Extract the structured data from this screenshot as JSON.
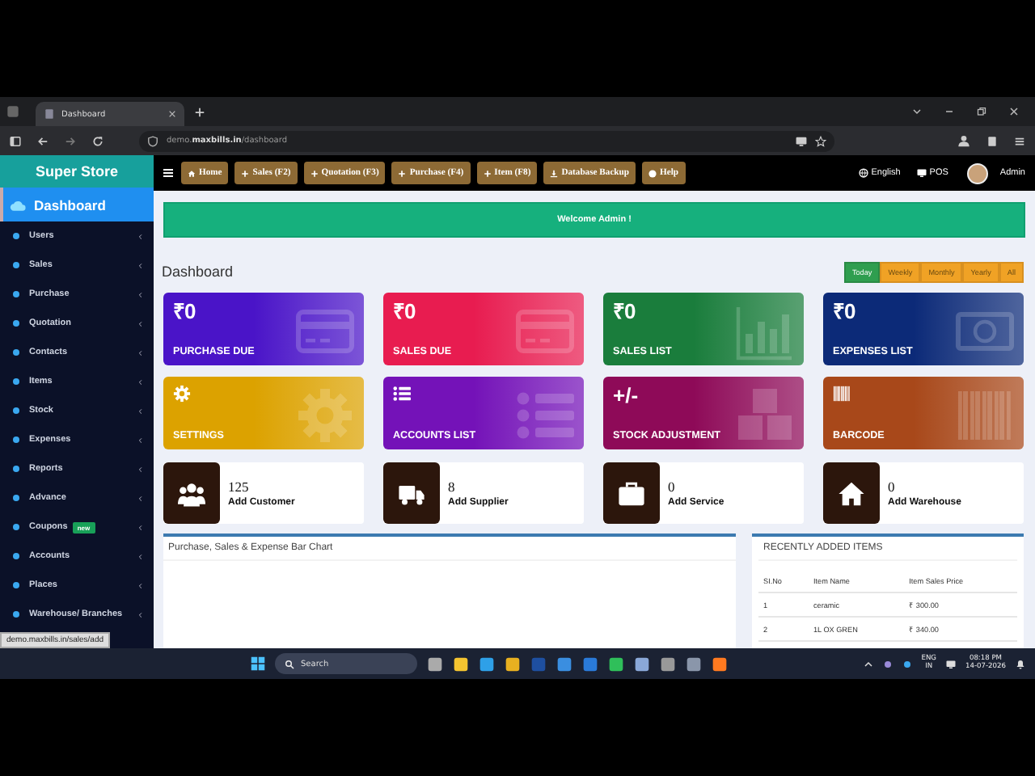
{
  "browser": {
    "tab_title": "Dashboard",
    "url": "demo.**maxbills.in**/dashboard"
  },
  "sidebar": {
    "brand": "Super Store",
    "items": [
      {
        "label": "Dashboard",
        "selected": true
      },
      {
        "label": "Users",
        "selected": false
      },
      {
        "label": "Sales",
        "selected": false
      },
      {
        "label": "Purchase",
        "selected": false
      },
      {
        "label": "Quotation",
        "selected": false
      },
      {
        "label": "Contacts",
        "selected": false
      },
      {
        "label": "Items",
        "selected": false
      },
      {
        "label": "Stock",
        "selected": false
      },
      {
        "label": "Expenses",
        "selected": false
      },
      {
        "label": "Reports",
        "selected": false
      },
      {
        "label": "Advance",
        "selected": false
      },
      {
        "label": "Coupons",
        "selected": false,
        "badge": "new"
      },
      {
        "label": "Accounts",
        "selected": false
      },
      {
        "label": "Places",
        "selected": false
      },
      {
        "label": "Warehouse/ Branches",
        "selected": false
      }
    ]
  },
  "status_url": "demo.maxbills.in/sales/add",
  "topbar": {
    "buttons": [
      "Home",
      "Sales (F2)",
      "Quotation (F3)",
      "Purchase (F4)",
      "Item (F8)",
      "Database Backup",
      "Help"
    ],
    "language": "English",
    "pos": "POS",
    "user": "Admin"
  },
  "alert": "Welcome Admin !",
  "page_title": "Dashboard",
  "periods": [
    {
      "label": "Today",
      "selected": true
    },
    {
      "label": "Weekly",
      "selected": false
    },
    {
      "label": "Monthly",
      "selected": false
    },
    {
      "label": "Yearly",
      "selected": false
    },
    {
      "label": "All",
      "selected": false
    }
  ],
  "summary_cards": [
    {
      "kind": "amount",
      "value": "₹0",
      "label": "PURCHASE DUE",
      "color": "#4a14c8"
    },
    {
      "kind": "amount",
      "value": "₹0",
      "label": "SALES DUE",
      "color": "#e81c50"
    },
    {
      "kind": "amount",
      "value": "₹0",
      "label": "SALES LIST",
      "color": "#1a7d3c"
    },
    {
      "kind": "amount",
      "value": "₹0",
      "label": "EXPENSES LIST",
      "color": "#0c2a78"
    },
    {
      "kind": "icon",
      "label": "SETTINGS",
      "color": "#dca200"
    },
    {
      "kind": "icon",
      "label": "ACCOUNTS LIST",
      "color": "#7412b8"
    },
    {
      "kind": "symbol",
      "value": "+/-",
      "label": "STOCK ADJUSTMENT",
      "color": "#8e0a58"
    },
    {
      "kind": "icon",
      "label": "BARCODE",
      "color": "#a8481a"
    }
  ],
  "quick_cards": [
    {
      "count": "125",
      "label": "Add Customer"
    },
    {
      "count": "8",
      "label": "Add Supplier"
    },
    {
      "count": "0",
      "label": "Add Service"
    },
    {
      "count": "0",
      "label": "Add Warehouse"
    }
  ],
  "chart_panel": {
    "title": "Purchase, Sales & Expense Bar Chart"
  },
  "recent_items": {
    "title": "RECENTLY ADDED ITEMS",
    "columns": [
      "SI.No",
      "Item Name",
      "Item Sales Price"
    ],
    "rows": [
      [
        "1",
        "ceramic",
        "₹ 300.00"
      ],
      [
        "2",
        "1L OX GREN",
        "₹ 340.00"
      ]
    ]
  },
  "taskbar": {
    "search_placeholder": "Search",
    "language": "ENG",
    "region": "IN",
    "time": "08:18 PM",
    "date": "14-07-2026"
  }
}
